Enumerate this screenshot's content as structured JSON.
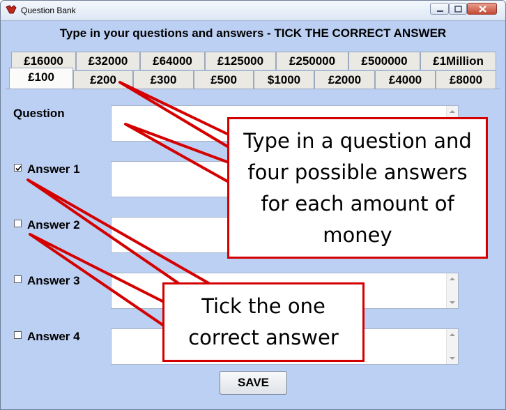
{
  "window": {
    "title": "Question Bank"
  },
  "instruction": "Type in your questions and answers - TICK THE CORRECT ANSWER",
  "tabs_row_back": [
    "£16000",
    "£32000",
    "£64000",
    "£125000",
    "£250000",
    "£500000",
    "£1Million"
  ],
  "tabs_row_front": [
    "£100",
    "£200",
    "£300",
    "£500",
    "$1000",
    "£2000",
    "£4000",
    "£8000"
  ],
  "active_tab": "£100",
  "form": {
    "question_label": "Question",
    "question_value": "",
    "answers": [
      {
        "label": "Answer 1",
        "checked": true,
        "value": ""
      },
      {
        "label": "Answer 2",
        "checked": false,
        "value": ""
      },
      {
        "label": "Answer 3",
        "checked": false,
        "value": ""
      },
      {
        "label": "Answer 4",
        "checked": false,
        "value": ""
      }
    ]
  },
  "save_label": "SAVE",
  "callouts": {
    "questions": "Type in a question and four possible answers for each amount of money",
    "tick": "Tick the one correct answer"
  },
  "colors": {
    "panel": "#bcd0f4",
    "callout_border": "#d40000",
    "tab": "#ebe9e4"
  },
  "icons": [
    "app-icon",
    "minimize-icon",
    "maximize-icon",
    "close-icon",
    "checkmark-icon"
  ]
}
